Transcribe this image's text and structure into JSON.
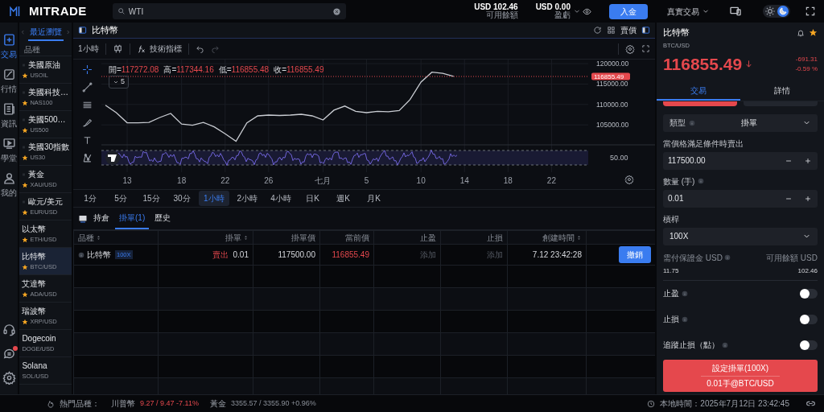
{
  "top_bar": {
    "logo": "MITRADE",
    "search": {
      "value": "WTI"
    },
    "balances": [
      {
        "amount": "USD 102.46",
        "label": "可用餘額",
        "menu": false
      },
      {
        "amount": "USD 0.00",
        "label": "盈虧",
        "menu": true
      }
    ],
    "deposit_button": "入金",
    "account_menu": "真實交易",
    "dark_mode": true
  },
  "nav": {
    "items": [
      {
        "label": "交易",
        "selected": true
      },
      {
        "label": "行情",
        "selected": false
      },
      {
        "label": "資訊",
        "selected": false
      },
      {
        "label": "學堂",
        "selected": false
      },
      {
        "label": "我的",
        "selected": false
      }
    ],
    "chat_unread": true
  },
  "watchlist": {
    "tab": "最近瀏覽",
    "header": "品種",
    "items": [
      {
        "name": "美國原油",
        "symbol": "USOIL",
        "starred": true,
        "draggable": true,
        "selected": false
      },
      {
        "name": "美國科技…",
        "symbol": "NAS100",
        "starred": true,
        "draggable": true,
        "selected": false
      },
      {
        "name": "美國500…",
        "symbol": "US500",
        "starred": true,
        "draggable": true,
        "selected": false
      },
      {
        "name": "美國30指數",
        "symbol": "US30",
        "starred": true,
        "draggable": true,
        "selected": false
      },
      {
        "name": "黃金",
        "symbol": "XAU/USD",
        "starred": true,
        "draggable": true,
        "selected": false
      },
      {
        "name": "歐元/美元",
        "symbol": "EUR/USD",
        "starred": true,
        "draggable": true,
        "selected": false
      },
      {
        "name": "以太幣",
        "symbol": "ETH/USD",
        "starred": true,
        "draggable": false,
        "selected": false
      },
      {
        "name": "比特幣",
        "symbol": "BTC/USD",
        "starred": true,
        "draggable": false,
        "selected": true
      },
      {
        "name": "艾達幣",
        "symbol": "ADA/USD",
        "starred": true,
        "draggable": false,
        "selected": false
      },
      {
        "name": "瑞波幣",
        "symbol": "XRP/USD",
        "starred": true,
        "draggable": false,
        "selected": false
      },
      {
        "name": "Dogecoin",
        "symbol": "DOGE/USD",
        "starred": false,
        "draggable": false,
        "selected": false
      },
      {
        "name": "Solana",
        "symbol": "SOL/USD",
        "starred": false,
        "draggable": false,
        "selected": false
      }
    ]
  },
  "chart_panel": {
    "title": "比特幣",
    "price_mode": "賣價",
    "interval": "1小時",
    "indicators_button": "技術指標",
    "ohlc": [
      {
        "label": "開=",
        "value": "117272.08"
      },
      {
        "label": "高=",
        "value": "117344.16"
      },
      {
        "label": "低=",
        "value": "116855.48"
      },
      {
        "label": "收=",
        "value": "116855.49"
      }
    ],
    "study_count": "5",
    "oscillator_tick": "50.00",
    "chart_data": {
      "type": "line",
      "categories": [
        null,
        null,
        "13",
        null,
        null,
        null,
        null,
        "18",
        null,
        null,
        null,
        "22",
        null,
        null,
        null,
        "26",
        null,
        null,
        null,
        null,
        "七月",
        null,
        null,
        null,
        "5",
        null,
        null,
        null,
        null,
        "10",
        null,
        null,
        null,
        "14",
        null,
        null,
        null,
        "18",
        null,
        null,
        null,
        "22",
        null,
        null
      ],
      "values": [
        109800,
        108000,
        105500,
        105500,
        105600,
        106800,
        107800,
        105200,
        104900,
        105600,
        104500,
        102800,
        101000,
        105500,
        107200,
        107400,
        107300,
        107400,
        107600,
        107200,
        106200,
        108600,
        109600,
        108300,
        108000,
        108300,
        108200,
        108500,
        111200,
        115500,
        117900,
        117600,
        116900,
        null,
        null,
        null,
        null,
        null,
        null,
        null,
        null,
        null,
        null,
        null
      ],
      "ylim": [
        100500,
        121000
      ],
      "grid": true,
      "ref_lines": [
        {
          "axis": "y",
          "value": 116855.49,
          "label": "116855.49",
          "color": "#e5484d"
        }
      ],
      "yticks": [
        {
          "value": 105000,
          "label": "105000.00"
        },
        {
          "value": 110000,
          "label": "110000.00"
        },
        {
          "value": 115000,
          "label": "115000.00"
        },
        {
          "value": 120000,
          "label": "120000.00"
        }
      ]
    },
    "timeframes": [
      {
        "label": "1分",
        "selected": false
      },
      {
        "label": "5分",
        "selected": false
      },
      {
        "label": "15分",
        "selected": false
      },
      {
        "label": "30分",
        "selected": false
      },
      {
        "label": "1小時",
        "selected": true
      },
      {
        "label": "2小時",
        "selected": false
      },
      {
        "label": "4小時",
        "selected": false
      },
      {
        "label": "日K",
        "selected": false
      },
      {
        "label": "週K",
        "selected": false
      },
      {
        "label": "月K",
        "selected": false
      }
    ]
  },
  "orders_panel": {
    "tabs": [
      {
        "label": "持倉",
        "selected": false
      },
      {
        "label": "掛單(1)",
        "selected": true
      },
      {
        "label": "歷史",
        "selected": false
      }
    ],
    "columns": [
      {
        "label": "品種",
        "sortable": true
      },
      {
        "label": "掛單",
        "sortable": true
      },
      {
        "label": "掛單價",
        "sortable": false
      },
      {
        "label": "當前價",
        "sortable": false
      },
      {
        "label": "止盈",
        "sortable": false
      },
      {
        "label": "止損",
        "sortable": false
      },
      {
        "label": "創建時間",
        "sortable": true
      }
    ],
    "rows": [
      {
        "instrument": "比特幣",
        "leverage": "100X",
        "side": "賣出",
        "volume": "0.01",
        "order_price": "117500.00",
        "current_price": "116855.49",
        "take_profit": "添加",
        "stop_loss": "添加",
        "created": "7.12 23:42:28",
        "action": "撤銷"
      }
    ]
  },
  "trade_panel": {
    "name": "比特幣",
    "symbol": "BTC/USD",
    "price": "116855.49",
    "change": "-691.31",
    "change_pct": "-0.59 %",
    "tabs": [
      {
        "label": "交易",
        "selected": true
      },
      {
        "label": "詳情",
        "selected": false
      }
    ],
    "sides": [
      {
        "selected": true
      },
      {
        "selected": false
      }
    ],
    "order_type": {
      "label": "類型",
      "value": "掛單"
    },
    "fields": [
      {
        "label": "當價格滿足條件時賣出",
        "value": "117500.00",
        "kind": "stepper",
        "info": false
      },
      {
        "label": "數量 (手)",
        "value": "0.01",
        "kind": "stepper",
        "info": true
      },
      {
        "label": "槓桿",
        "value": "100X",
        "kind": "select",
        "info": false
      }
    ],
    "margin": {
      "label": "需付保證金 USD",
      "value": "11.75"
    },
    "available": {
      "label": "可用餘額 USD",
      "value": "102.46"
    },
    "toggles": [
      {
        "label": "止盈",
        "on": false
      },
      {
        "label": "止損",
        "on": false
      },
      {
        "label": "追蹤止損（點）",
        "on": false
      }
    ],
    "submit": {
      "label": "設定掛單(100X)",
      "detail": "0.01手@BTC/USD"
    }
  },
  "status_bar": {
    "hot_label": "熱門品種：",
    "hot_items": [
      {
        "name": "川普幣",
        "quote": "9.27 / 9.47 -7.11%",
        "negative": true
      },
      {
        "name": "黃金",
        "quote": "3355.57 / 3355.90 +0.96%",
        "negative": false
      }
    ],
    "local_time": "本地時間：2025年7月12日 23:42:45"
  }
}
